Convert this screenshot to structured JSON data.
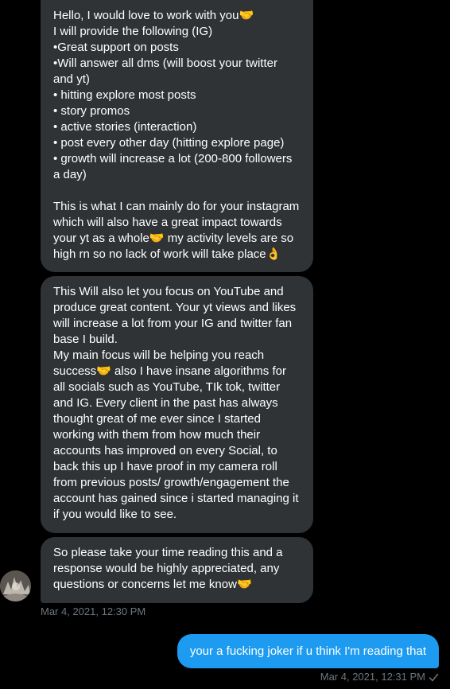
{
  "conversation": {
    "incoming": {
      "message_1": "Hello, I would love to work with you🤝\nI will provide the following (IG)\n•Great support on posts\n•Will answer all dms (will boost your twitter and yt)\n• hitting explore most posts\n• story promos\n• active stories (interaction)\n• post every other day (hitting explore page)\n• growth will increase a lot (200-800 followers a day)\n\nThis is what I can mainly do for your instagram which will also have a great impact towards your yt as a whole🤝 my activity levels are so high rn so no lack of work will take place👌",
      "message_2": "This Will also let you focus on YouTube and produce great content. Your yt views and likes will increase a lot from your IG and twitter fan base I build.\nMy main focus will be helping you reach success🤝 also I have insane algorithms for all socials such as YouTube, TIk tok, twitter and IG. Every client in the past has always thought great of me ever since I started working with them from how much their accounts has improved on every Social, to back this up I have proof in my camera roll from previous posts/ growth/engagement the account has gained since i started managing it if you would like to see.",
      "message_3": "So please take your time reading this and a response would be highly appreciated, any questions or concerns let me know🤝",
      "timestamp": "Mar 4, 2021, 12:30 PM"
    },
    "outgoing": {
      "message": "your a fucking joker if u think I'm reading that",
      "timestamp": "Mar 4, 2021, 12:31 PM",
      "status_icon": "check-icon"
    }
  },
  "colors": {
    "background": "#000000",
    "incoming_bubble": "#2f3336",
    "outgoing_bubble": "#1d9bf0",
    "timestamp": "#6e767d"
  }
}
